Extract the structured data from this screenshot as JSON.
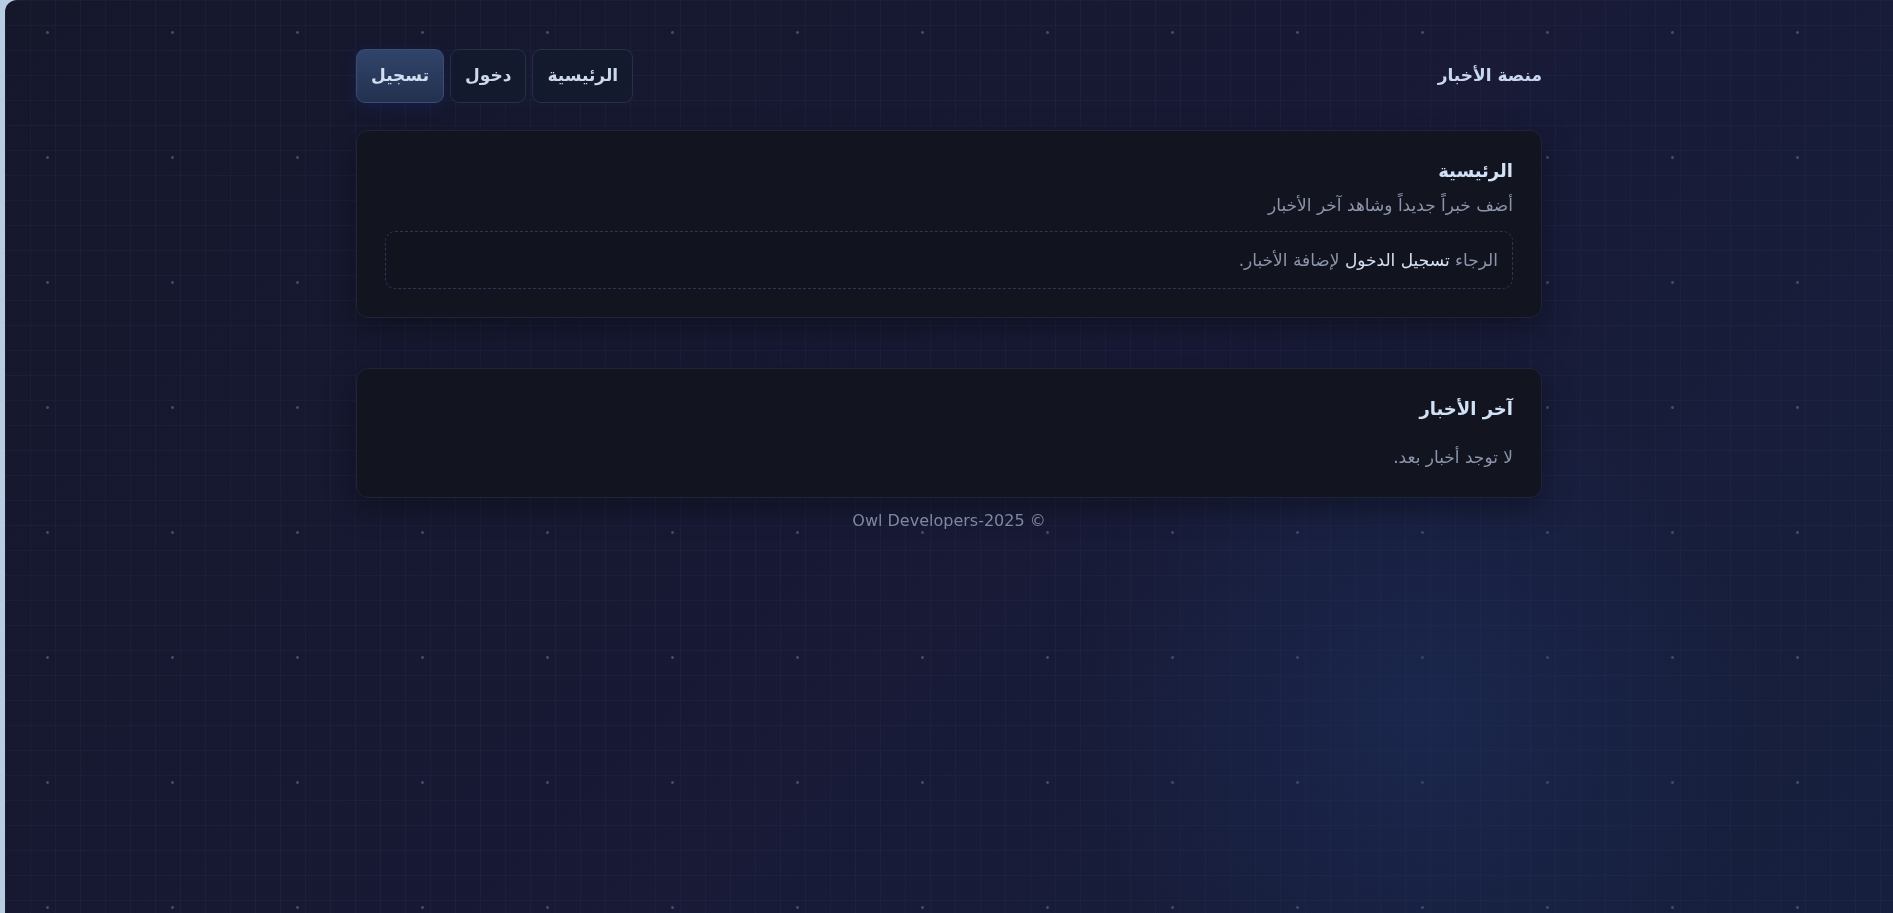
{
  "header": {
    "title": "منصة الأخبار",
    "tabs": [
      {
        "label": "الرئيسية",
        "selected": false
      },
      {
        "label": "دخول",
        "selected": false
      },
      {
        "label": "تسجيل",
        "selected": true
      }
    ]
  },
  "home_card": {
    "title": "الرئيسية",
    "subtitle": "أضف خبراً جديداً وشاهد آخر الأخبار",
    "notice": {
      "before": "الرجاء",
      "link": "تسجيل الدخول",
      "after": "لإضافة الأخبار."
    }
  },
  "news_card": {
    "title": "آخر الأخبار",
    "empty_text": "لا توجد أخبار بعد."
  },
  "footer": {
    "text": "Owl Developers-2025 ©"
  }
}
